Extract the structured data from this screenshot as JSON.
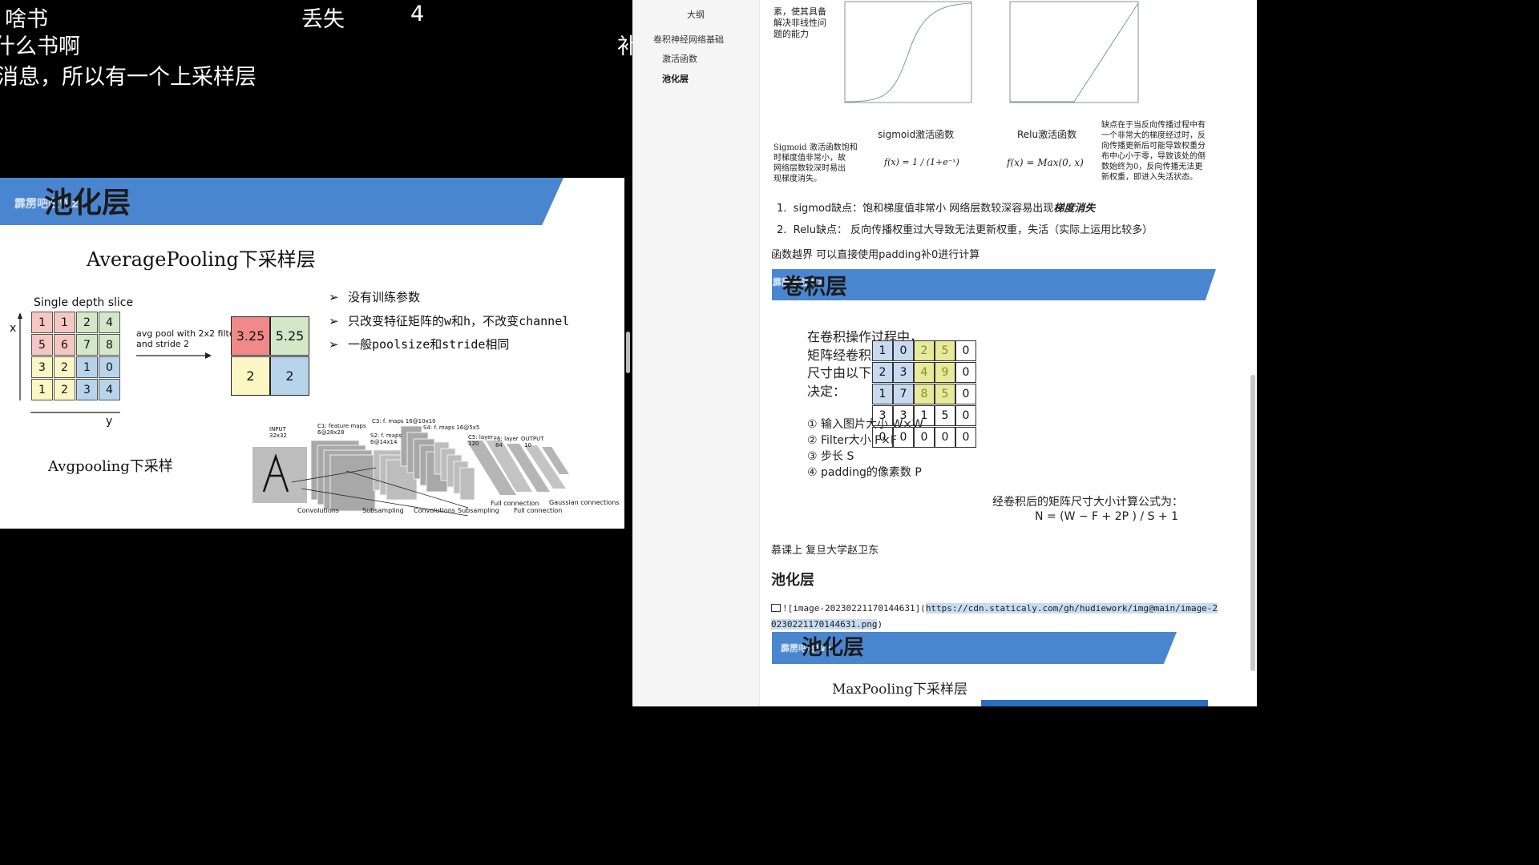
{
  "video": {
    "subtitles": [
      "啥书",
      "丢失",
      "4",
      "什么书啊",
      "补",
      "消息，所以有一个上采样层"
    ],
    "slide": {
      "banner_title": "池化层",
      "watermark": "霹雳吧啦Wz",
      "heading": "AveragePooling下采样层",
      "single_depth_label": "Single depth slice",
      "axis_x": "x",
      "axis_y": "y",
      "input_grid": [
        [
          "1",
          "1",
          "2",
          "4"
        ],
        [
          "5",
          "6",
          "7",
          "8"
        ],
        [
          "3",
          "2",
          "1",
          "0"
        ],
        [
          "1",
          "2",
          "3",
          "4"
        ]
      ],
      "op_label_1": "avg pool with 2x2 filters",
      "op_label_2": "and stride 2",
      "output_grid": [
        [
          "3.25",
          "5.25"
        ],
        [
          "2",
          "2"
        ]
      ],
      "bullets": [
        "没有训练参数",
        "只改变特征矩阵的w和h，不改变channel",
        "一般poolsize和stride相同"
      ],
      "caption": "Avgpooling下采样",
      "lenet_labels": {
        "input": "INPUT",
        "input_size": "32x32",
        "c1": "C1: feature maps",
        "c1_size": "6@28x28",
        "s2": "S2: f. maps",
        "s2_size": "6@14x14",
        "c3": "C3: f. maps 16@10x10",
        "s4": "S4: f. maps 16@5x5",
        "c5": "C5: layer",
        "c5_size": "120",
        "f6": "F6: layer",
        "f6_size": "84",
        "output": "OUTPUT",
        "output_size": "10",
        "convolutions": "Convolutions",
        "subsampling": "Subsampling",
        "convolutions2": "Convolutions",
        "subsampling2": "Subsampling",
        "full1": "Full connection",
        "full2": "Full connection",
        "gaussian": "Gaussian connections"
      }
    }
  },
  "doc": {
    "outline": {
      "title": "大纲",
      "items": [
        "卷积神经网络基础",
        "激活函数",
        "池化层"
      ]
    },
    "activation": {
      "intro_lines": [
        "素，使其具备",
        "解决非线性问",
        "题的能力"
      ],
      "sigmoid_title": "sigmoid激活函数",
      "relu_title": "Relu激活函数",
      "sigmoid_note": [
        "Sigmoid 激活函数饱和",
        "时梯度值非常小，故",
        "网络层数较深时易出",
        "现梯度消失。"
      ],
      "sigmoid_formula": "f(x) = 1 / (1+e⁻ˣ)",
      "relu_formula": "f(x) = Max(0, x)",
      "relu_note": [
        "缺点在于当反向传播过程中有",
        "一个非常大的梯度经过时，反",
        "向传播更新后可能导致权重分",
        "布中心小于零，导致该处的倒",
        "数始终为0，反向传播无法更",
        "新权重，即进入失活状态。"
      ]
    },
    "list": [
      {
        "num": "1.",
        "text": "sigmod缺点：饱和梯度值非常小 网络层数较深容易出现",
        "em": "梯度消失"
      },
      {
        "num": "2.",
        "text": "Relu缺点： 反向传播权重过大导致无法更新权重，失活（实际上运用比较多）",
        "em": ""
      }
    ],
    "note_padding": "函数越界 可以直接使用padding补0进行计算",
    "conv_banner": "卷积层",
    "conv": {
      "intro": [
        "在卷积操作过程中，",
        "矩阵经卷积操作后的",
        "尺寸由以下几个因数",
        "决定："
      ],
      "factors": [
        "①  输入图片大小 W×W",
        "②  Filter大小 F×F",
        "③  步长 S",
        "④  padding的像素数 P"
      ],
      "matrix": [
        [
          "1",
          "0",
          "2",
          "5",
          "0"
        ],
        [
          "2",
          "3",
          "4",
          "9",
          "0"
        ],
        [
          "1",
          "7",
          "8",
          "5",
          "0"
        ],
        [
          "3",
          "3",
          "1",
          "5",
          "0"
        ],
        [
          "0",
          "0",
          "0",
          "0",
          "0"
        ]
      ],
      "formula_label": "经卷积后的矩阵尺寸大小计算公式为：",
      "formula": "N = (W − F + 2P ) / S + 1"
    },
    "source": "慕课上 复旦大学赵卫东",
    "pool_heading": "池化层",
    "image_link_prefix": "![image-20230221170144631](",
    "image_link_url": "https://cdn.staticaly.com/gh/hudiework/img@main/image-20230221170144631.png",
    "image_link_suffix": ")",
    "pool_banner": "池化层",
    "maxpool_heading": "MaxPooling下采样层"
  },
  "colors": {
    "banner": "#4a86d0",
    "pink": "#f4c7c3",
    "green": "#d4e8c9",
    "yellow": "#fbf7c4",
    "blue": "#b8d4ea",
    "red_cell": "#f08a8a",
    "matrix_blue": "#c7daf0",
    "matrix_yellow": "#e7ea9a"
  }
}
